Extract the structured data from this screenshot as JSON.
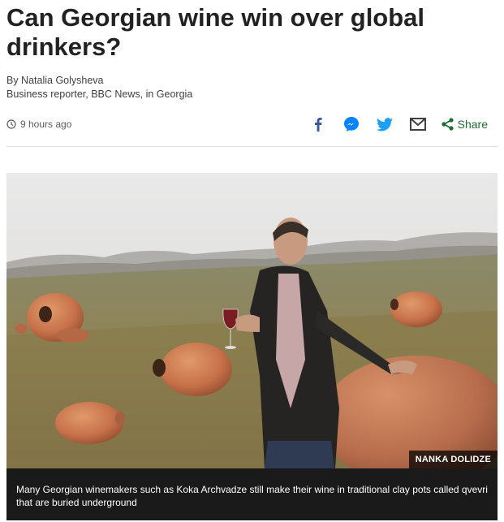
{
  "article": {
    "headline": "Can Georgian wine win over global drinkers?",
    "author_line": "By Natalia Golysheva",
    "author_role": "Business reporter, BBC News, in Georgia",
    "timestamp": "9 hours ago"
  },
  "share": {
    "icons": [
      "facebook-icon",
      "messenger-icon",
      "twitter-icon",
      "email-icon",
      "share-icon"
    ],
    "share_label": "Share"
  },
  "figure": {
    "credit": "NANKA DOLIDZE",
    "caption": "Many Georgian winemakers such as Koka Archvadze still make their wine in traditional clay pots called qvevri that are buried underground"
  },
  "colors": {
    "text": "#222222",
    "share_green": "#1f6b32",
    "facebook_blue": "#3b5998",
    "messenger_blue": "#0084ff",
    "twitter_blue": "#1da1f2",
    "caption_bg": "#1a1a1a"
  }
}
